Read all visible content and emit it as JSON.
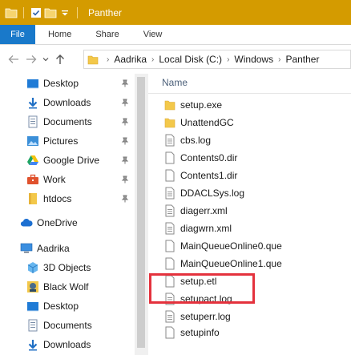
{
  "window": {
    "title": "Panther"
  },
  "ribbon": {
    "tabs": [
      "File",
      "Home",
      "Share",
      "View"
    ]
  },
  "address": {
    "crumbs": [
      "Aadrika",
      "Local Disk (C:)",
      "Windows",
      "Panther"
    ]
  },
  "nav": {
    "quick_access": [
      {
        "label": "Desktop",
        "icon": "desktop-icon",
        "pinned": true
      },
      {
        "label": "Downloads",
        "icon": "download-arrow-icon",
        "pinned": true
      },
      {
        "label": "Documents",
        "icon": "documents-icon",
        "pinned": true
      },
      {
        "label": "Pictures",
        "icon": "pictures-icon",
        "pinned": true
      },
      {
        "label": "Google Drive",
        "icon": "google-drive-icon",
        "pinned": true
      },
      {
        "label": "Work",
        "icon": "briefcase-icon",
        "pinned": true
      },
      {
        "label": "htdocs",
        "icon": "folder-icon",
        "pinned": true
      }
    ],
    "onedrive": {
      "label": "OneDrive",
      "icon": "cloud-icon"
    },
    "this_pc": {
      "label": "Aadrika",
      "icon": "computer-icon",
      "items": [
        {
          "label": "3D Objects",
          "icon": "cube-icon"
        },
        {
          "label": "Black Wolf",
          "icon": "wolf-image-icon"
        },
        {
          "label": "Desktop",
          "icon": "desktop-icon"
        },
        {
          "label": "Documents",
          "icon": "documents-icon"
        },
        {
          "label": "Downloads",
          "icon": "download-arrow-icon"
        }
      ]
    }
  },
  "content": {
    "column_header": "Name",
    "files": [
      {
        "name": "setup.exe",
        "type": "folder"
      },
      {
        "name": "UnattendGC",
        "type": "folder"
      },
      {
        "name": "cbs.log",
        "type": "file"
      },
      {
        "name": "Contents0.dir",
        "type": "file"
      },
      {
        "name": "Contents1.dir",
        "type": "file"
      },
      {
        "name": "DDACLSys.log",
        "type": "file"
      },
      {
        "name": "diagerr.xml",
        "type": "file"
      },
      {
        "name": "diagwrn.xml",
        "type": "file"
      },
      {
        "name": "MainQueueOnline0.que",
        "type": "file"
      },
      {
        "name": "MainQueueOnline1.que",
        "type": "file"
      },
      {
        "name": "setup.etl",
        "type": "file"
      },
      {
        "name": "setupact.log",
        "type": "file",
        "highlighted": true
      },
      {
        "name": "setuperr.log",
        "type": "file"
      },
      {
        "name": "setupinfo",
        "type": "file"
      }
    ]
  },
  "colors": {
    "titlebar": "#d49b00",
    "file_tab": "#1979ca",
    "highlight_box": "#e4323d"
  }
}
